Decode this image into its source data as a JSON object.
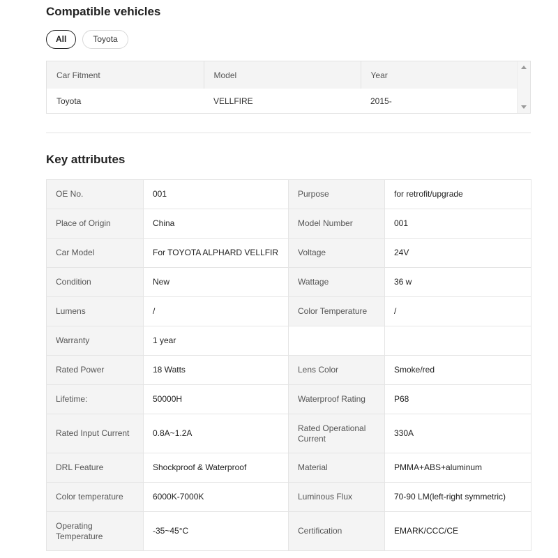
{
  "compatible": {
    "title": "Compatible vehicles",
    "filters": [
      "All",
      "Toyota"
    ],
    "active_filter": "All",
    "columns": [
      "Car Fitment",
      "Model",
      "Year"
    ],
    "rows": [
      [
        "Toyota",
        "VELLFIRE",
        "2015-"
      ]
    ]
  },
  "attributes": {
    "title": "Key attributes",
    "rows": [
      [
        "OE No.",
        "001",
        "Purpose",
        "for retrofit/upgrade"
      ],
      [
        "Place of Origin",
        "China",
        "Model Number",
        "001"
      ],
      [
        "Car Model",
        "For TOYOTA ALPHARD VELLFIR",
        "Voltage",
        "24V"
      ],
      [
        "Condition",
        "New",
        "Wattage",
        "36 w"
      ],
      [
        "Lumens",
        "/",
        "Color Temperature",
        "/"
      ],
      [
        "Warranty",
        "1 year",
        "",
        ""
      ],
      [
        "Rated Power",
        "18 Watts",
        "Lens Color",
        "Smoke/red"
      ],
      [
        "Lifetime:",
        "50000H",
        "Waterproof Rating",
        "P68"
      ],
      [
        "Rated Input Current",
        "0.8A~1.2A",
        "Rated Operational Current",
        "330A"
      ],
      [
        "DRL Feature",
        "Shockproof & Waterproof",
        "Material",
        "PMMA+ABS+aluminum"
      ],
      [
        "Color temperature",
        "6000K-7000K",
        "Luminous Flux",
        "70-90 LM(left-right symmetric)"
      ],
      [
        "Operating Temperature",
        "-35~45°C",
        "Certification",
        "EMARK/CCC/CE"
      ]
    ]
  }
}
